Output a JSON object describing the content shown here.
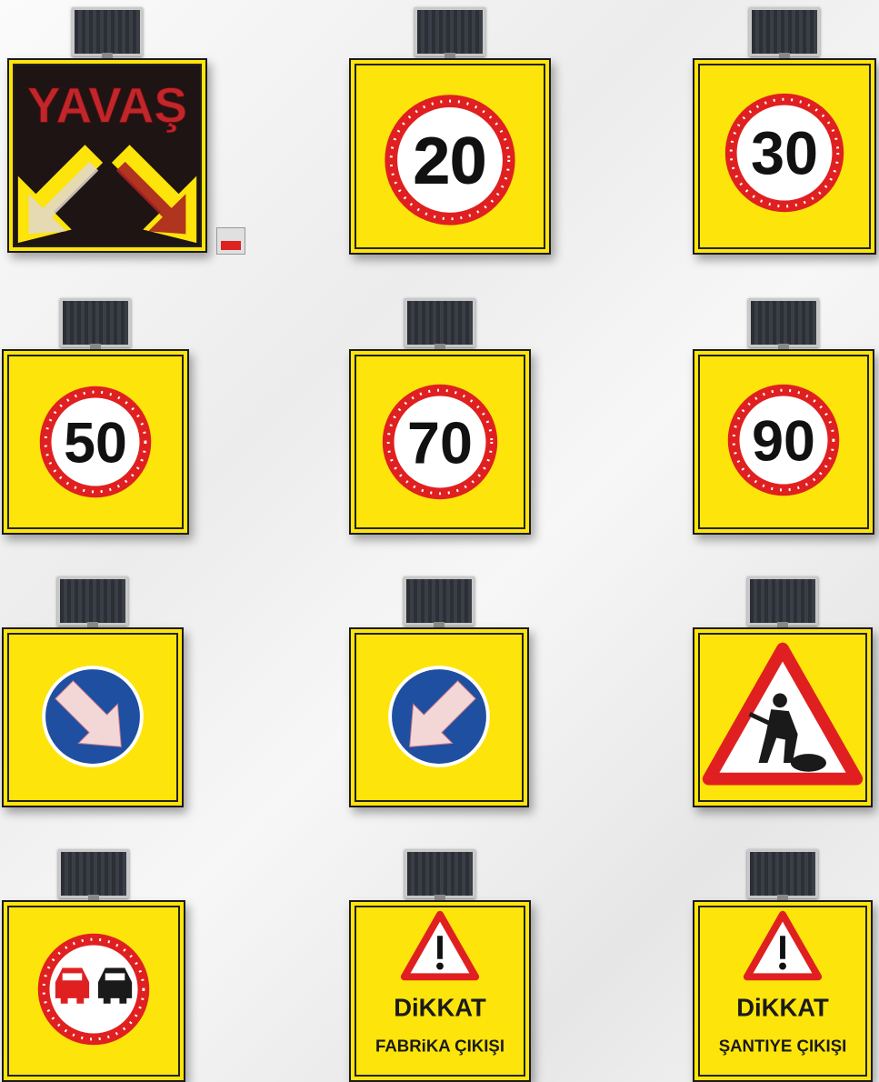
{
  "signs": [
    {
      "id": "yavas",
      "text": "YAVAŞ"
    },
    {
      "id": "speed-20",
      "text": "20"
    },
    {
      "id": "speed-30",
      "text": "30"
    },
    {
      "id": "speed-50",
      "text": "50"
    },
    {
      "id": "speed-70",
      "text": "70"
    },
    {
      "id": "speed-90",
      "text": "90"
    },
    {
      "id": "keep-right",
      "icon": "arrow-down-right-icon"
    },
    {
      "id": "keep-left",
      "icon": "arrow-down-left-icon"
    },
    {
      "id": "road-works",
      "icon": "roadworks-worker-icon"
    },
    {
      "id": "no-overtaking",
      "icon": "no-overtaking-cars-icon"
    },
    {
      "id": "dikkat-fabrika",
      "title": "DiKKAT",
      "subtitle": "FABRiKA ÇIKIŞI"
    },
    {
      "id": "dikkat-santiye",
      "title": "DiKKAT",
      "subtitle": "ŞANTIYE ÇIKIŞI"
    }
  ],
  "colors": {
    "board": "#fde40a",
    "ring": "#e02020",
    "blue": "#1f4fa0",
    "led": "#8b2a2a"
  }
}
